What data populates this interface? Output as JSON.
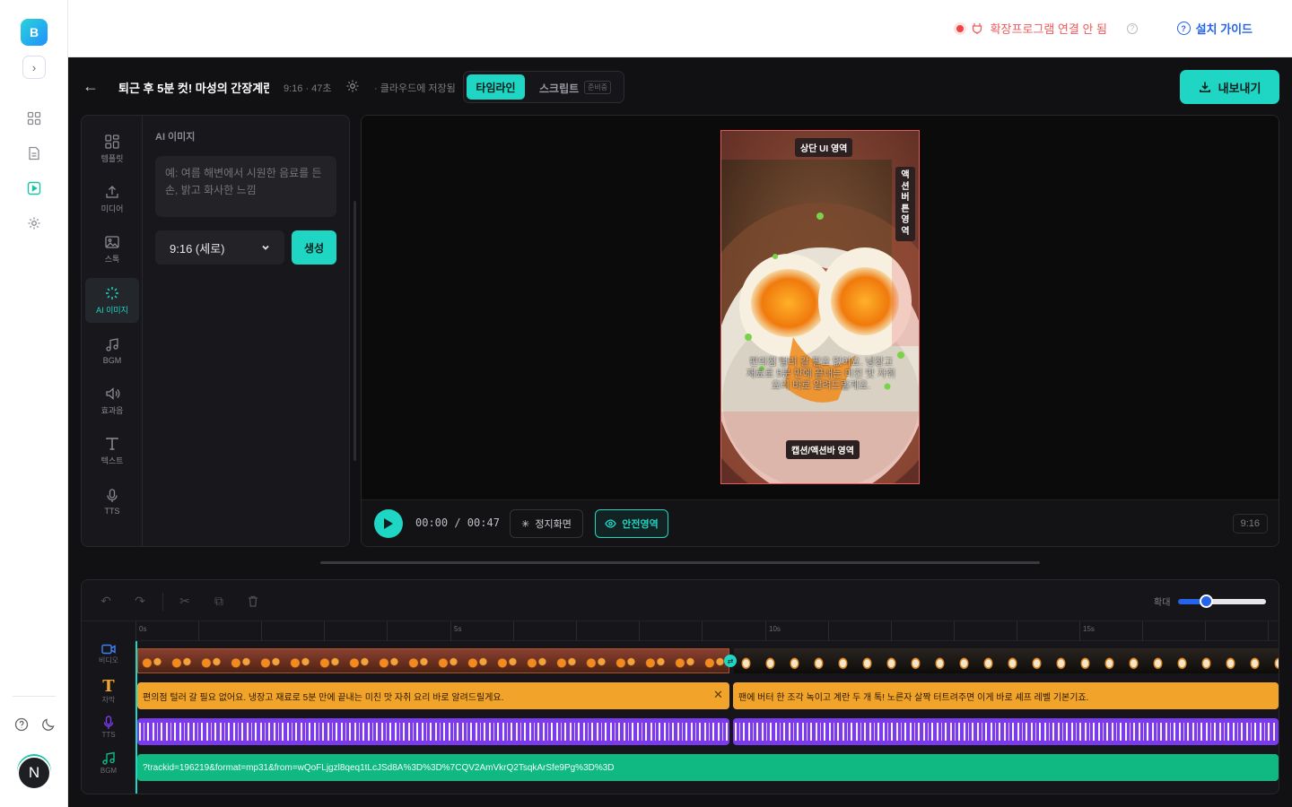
{
  "app": {
    "logo_letter": "B",
    "avatar_letter": "N"
  },
  "topbar": {
    "ext_status": "확장프로그램 연결 안 됨",
    "guide": "설치 가이드"
  },
  "header": {
    "title": "퇴근 후 5분 컷! 마성의 간장계란밥",
    "meta": "9:16 · 47초",
    "saved": "· 클라우드에 저장됨",
    "tab_timeline": "타임라인",
    "tab_script": "스크립트",
    "tab_script_badge": "준비중",
    "export": "내보내기"
  },
  "tools": [
    {
      "label": "템플릿",
      "icon": "template-icon"
    },
    {
      "label": "미디어",
      "icon": "upload-icon"
    },
    {
      "label": "스톡",
      "icon": "image-icon"
    },
    {
      "label": "AI 이미지",
      "icon": "sparkle-icon",
      "active": true
    },
    {
      "label": "BGM",
      "icon": "music-icon"
    },
    {
      "label": "효과음",
      "icon": "speaker-icon"
    },
    {
      "label": "텍스트",
      "icon": "text-icon"
    },
    {
      "label": "TTS",
      "icon": "mic-icon"
    }
  ],
  "ai_panel": {
    "title": "AI 이미지",
    "placeholder": "예: 여름 해변에서 시원한 음료를 든 손, 밝고 화사한 느낌",
    "ratio": "9:16 (세로)",
    "generate": "생성"
  },
  "preview": {
    "zone_top": "상단 UI 영역",
    "zone_right": "액션버튼영역",
    "zone_bottom": "캡션/액션바 영역",
    "ghost_caption": "편의점 털러 갈 필요 없어요. 냉장고 재료로 5분 만에 끝내는 미친 맛 자취 요리 바로 알려드릴게요.",
    "time": "00:00  /  00:47",
    "still": "정지화면",
    "safe": "안전영역",
    "ratio": "9:16"
  },
  "timeline": {
    "zoom_label": "확대",
    "zoom_value": 0.3,
    "ruler": [
      "0s",
      "5s",
      "10s",
      "15s"
    ],
    "tracks": [
      {
        "label": "비디오",
        "icon": "video-icon"
      },
      {
        "label": "자막",
        "icon": "text-icon"
      },
      {
        "label": "TTS",
        "icon": "mic-icon"
      },
      {
        "label": "BGM",
        "icon": "music-icon"
      }
    ],
    "subtitle_1": "편의점 털러 갈 필요 없어요. 냉장고 재료로 5분 만에 끝내는 미친 맛 자취 요리 바로 알려드릴게요.",
    "subtitle_2": "팬에 버터 한 조각 녹이고 계란 두 개 톡! 노른자 살짝 터트려주면 이게 바로 셰프 레벨 기본기죠.",
    "bgm": "?trackid=196219&format=mp31&from=wQoFLjgzl8qeq1tLcJSd8A%3D%3D%7CQV2AmVkrQ2TsqkArSfe9Pg%3D%3D"
  },
  "colors": {
    "accent": "#1ed6c3",
    "subtitle": "#f2a42a",
    "tts": "#7c3aed",
    "bgm": "#10b981",
    "danger": "#ef4444"
  }
}
